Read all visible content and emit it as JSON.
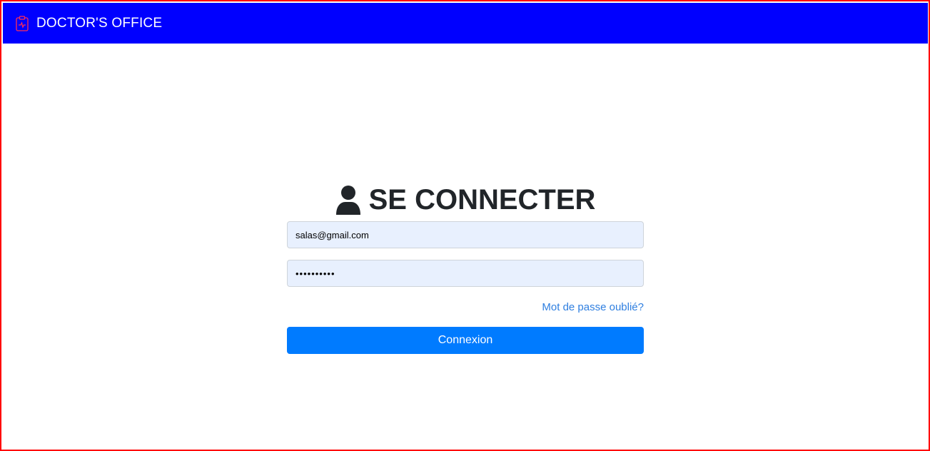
{
  "navbar": {
    "brand_icon": "clipboard-pulse-icon",
    "brand_icon_color": "#ff2d55",
    "brand_text": "DOCTOR'S OFFICE",
    "background": "#0000ff"
  },
  "login": {
    "title_icon": "user-icon",
    "title": "SE CONNECTER",
    "email_value": "salas@gmail.com",
    "password_value": "••••••••••",
    "forgot_link": "Mot de passe oublié?",
    "submit_label": "Connexion",
    "accent_color": "#007bff"
  }
}
